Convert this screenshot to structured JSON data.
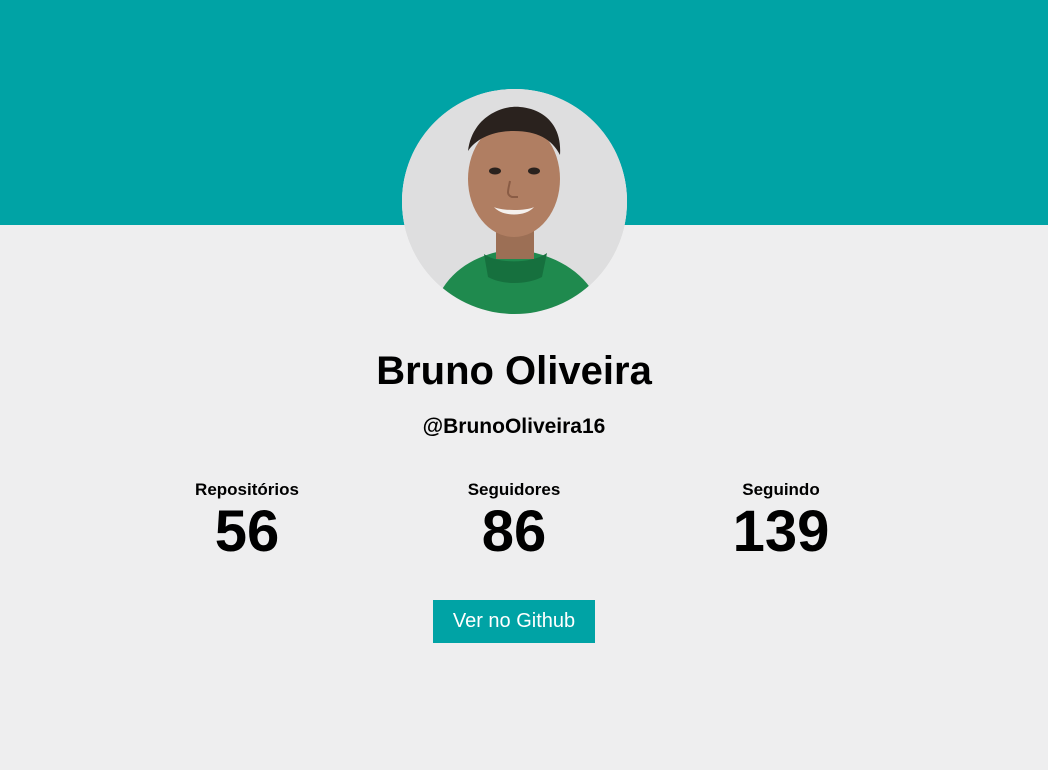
{
  "profile": {
    "name": "Bruno Oliveira",
    "username": "@BrunoOliveira16",
    "avatar_icon": "profile-photo"
  },
  "stats": {
    "repos_label": "Repositórios",
    "repos_value": "56",
    "followers_label": "Seguidores",
    "followers_value": "86",
    "following_label": "Seguindo",
    "following_value": "139"
  },
  "actions": {
    "github_button_label": "Ver no Github"
  },
  "colors": {
    "accent": "#00a3a5",
    "background": "#eeeeef",
    "text": "#000000",
    "button_text": "#ffffff"
  }
}
